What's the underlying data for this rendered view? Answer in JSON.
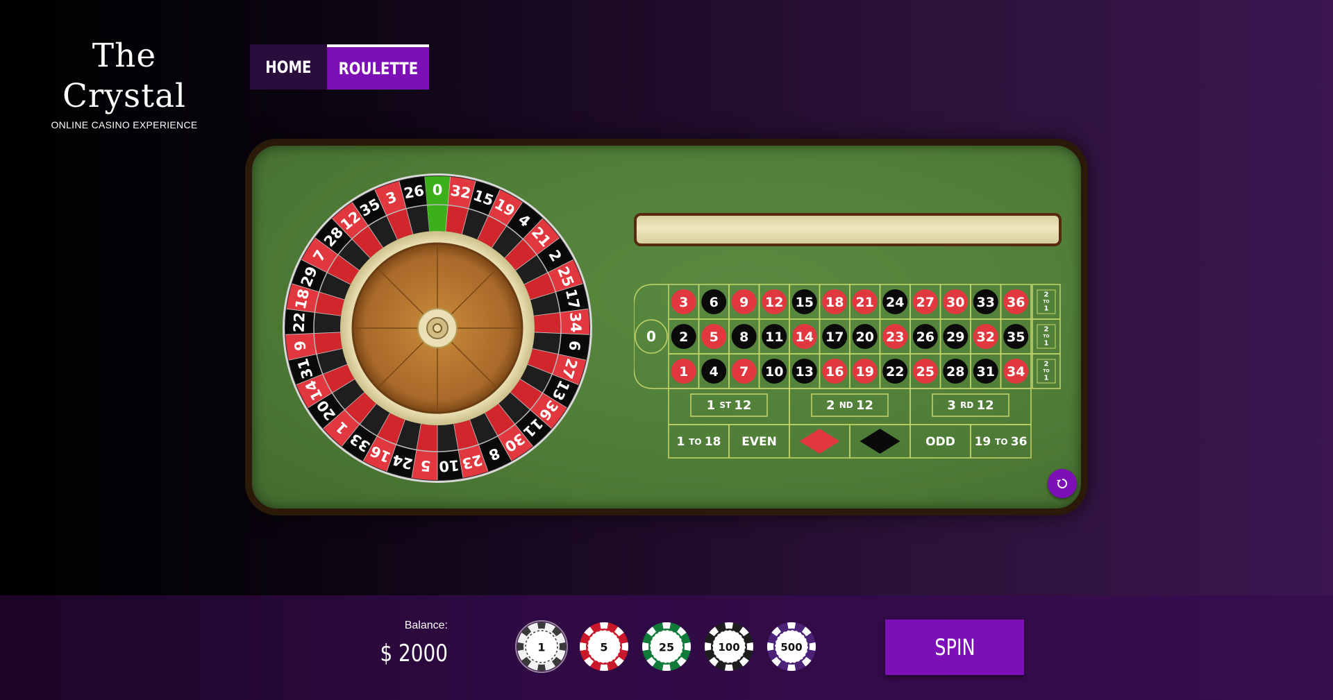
{
  "brand": {
    "title": "The Crystal",
    "subtitle": "ONLINE CASINO EXPERIENCE"
  },
  "nav": {
    "tabs": [
      {
        "label": "HOME",
        "active": false
      },
      {
        "label": "ROULETTE",
        "active": true
      }
    ]
  },
  "colors": {
    "accent": "#7c0fb5",
    "red": "#e0383e",
    "black": "#0a0a0a",
    "green": "#3cb01a",
    "felt": "#4f7d37",
    "line": "#c6d66a"
  },
  "wheel": {
    "pockets": [
      0,
      32,
      15,
      19,
      4,
      21,
      2,
      25,
      17,
      34,
      6,
      27,
      13,
      36,
      11,
      30,
      8,
      23,
      10,
      5,
      24,
      16,
      33,
      1,
      20,
      14,
      31,
      9,
      22,
      18,
      29,
      7,
      28,
      12,
      35,
      3,
      26
    ],
    "red_numbers": [
      1,
      3,
      5,
      7,
      9,
      12,
      14,
      16,
      18,
      19,
      21,
      23,
      25,
      27,
      30,
      32,
      34,
      36
    ],
    "highlighted_pocket": 0
  },
  "board": {
    "zero": "0",
    "rows": [
      [
        3,
        6,
        9,
        12,
        15,
        18,
        21,
        24,
        27,
        30,
        33,
        36
      ],
      [
        2,
        5,
        8,
        11,
        14,
        17,
        20,
        23,
        26,
        29,
        32,
        35
      ],
      [
        1,
        4,
        7,
        10,
        13,
        16,
        19,
        22,
        25,
        28,
        31,
        34
      ]
    ],
    "column_bet_label": {
      "top": "2",
      "mid": "TO",
      "bottom": "1"
    },
    "dozens": [
      {
        "num": "1",
        "suffix": "ST",
        "tail": "12"
      },
      {
        "num": "2",
        "suffix": "ND",
        "tail": "12"
      },
      {
        "num": "3",
        "suffix": "RD",
        "tail": "12"
      }
    ],
    "outside": {
      "low": {
        "a": "1",
        "b": "TO",
        "c": "18"
      },
      "even": "EVEN",
      "red_icon": "red-diamond-icon",
      "black_icon": "black-diamond-icon",
      "odd": "ODD",
      "high": {
        "a": "19",
        "b": "TO",
        "c": "36"
      }
    }
  },
  "balance": {
    "label": "Balance:",
    "value": "$ 2000"
  },
  "chips": [
    {
      "value": "1",
      "color": "#f2f2f2",
      "stripe": "#3a3a3a",
      "selected": true
    },
    {
      "value": "5",
      "color": "#c9182a",
      "stripe": "#ffffff",
      "selected": false
    },
    {
      "value": "25",
      "color": "#0f7a3a",
      "stripe": "#ffffff",
      "selected": false
    },
    {
      "value": "100",
      "color": "#1e1e1e",
      "stripe": "#ffffff",
      "selected": false
    },
    {
      "value": "500",
      "color": "#4b2478",
      "stripe": "#ffffff",
      "selected": false
    }
  ],
  "spin": {
    "label": "SPIN"
  },
  "reset": {
    "icon": "reset-icon"
  }
}
